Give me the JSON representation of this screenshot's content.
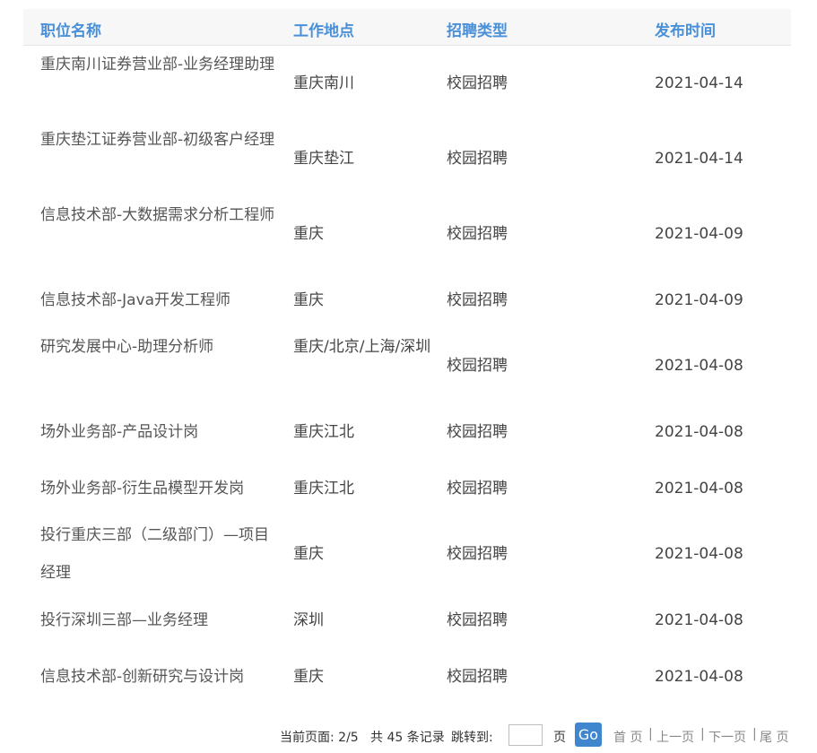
{
  "columns": [
    "职位名称",
    "工作地点",
    "招聘类型",
    "发布时间"
  ],
  "rows": [
    {
      "title": "重庆南川证券营业部-业务经理助理",
      "location": "重庆南川",
      "type": "校园招聘",
      "date": "2021-04-14"
    },
    {
      "title": "重庆垫江证券营业部-初级客户经理",
      "location": "重庆垫江",
      "type": "校园招聘",
      "date": "2021-04-14"
    },
    {
      "title": "信息技术部-大数据需求分析工程师",
      "location": "重庆",
      "type": "校园招聘",
      "date": "2021-04-09"
    },
    {
      "title": "信息技术部-Java开发工程师",
      "location": "重庆",
      "type": "校园招聘",
      "date": "2021-04-09"
    },
    {
      "title": "研究发展中心-助理分析师",
      "location": "重庆/北京/上海/深圳",
      "type": "校园招聘",
      "date": "2021-04-08"
    },
    {
      "title": "场外业务部-产品设计岗",
      "location": "重庆江北",
      "type": "校园招聘",
      "date": "2021-04-08"
    },
    {
      "title": "场外业务部-衍生品模型开发岗",
      "location": "重庆江北",
      "type": "校园招聘",
      "date": "2021-04-08"
    },
    {
      "title": "投行重庆三部（二级部门）—项目经理",
      "location": "重庆",
      "type": "校园招聘",
      "date": "2021-04-08"
    },
    {
      "title": "投行深圳三部—业务经理",
      "location": "深圳",
      "type": "校园招聘",
      "date": "2021-04-08"
    },
    {
      "title": "信息技术部-创新研究与设计岗",
      "location": "重庆",
      "type": "校园招聘",
      "date": "2021-04-08"
    }
  ],
  "pager": {
    "current_label": "当前页面: 2/5",
    "total_label": "共 45 条记录",
    "jump_label": "跳转到:",
    "jump_value": "",
    "page_unit": "页",
    "go_label": "Go",
    "first": "首 页",
    "prev": "上一页",
    "next": "下一页",
    "last": "尾 页",
    "separator": "|"
  },
  "colors": {
    "header_text": "#4a90d9",
    "go_button": "#3f86cf"
  }
}
